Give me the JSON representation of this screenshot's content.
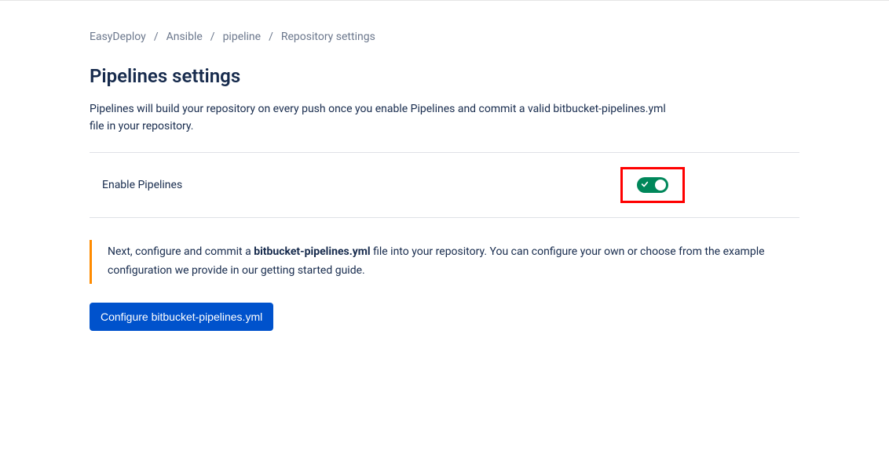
{
  "breadcrumb": {
    "items": [
      "EasyDeploy",
      "Ansible",
      "pipeline",
      "Repository settings"
    ]
  },
  "page": {
    "title": "Pipelines settings",
    "description": "Pipelines will build your repository on every push once you enable Pipelines and commit a valid bitbucket-pipelines.yml file in your repository."
  },
  "toggle": {
    "label": "Enable Pipelines",
    "enabled": true
  },
  "info": {
    "prefix": "Next, configure and commit a ",
    "filename": "bitbucket-pipelines.yml",
    "suffix": " file into your repository. You can configure your own or choose from the example configuration we provide in our getting started guide."
  },
  "button": {
    "configure_label": "Configure bitbucket-pipelines.yml"
  }
}
